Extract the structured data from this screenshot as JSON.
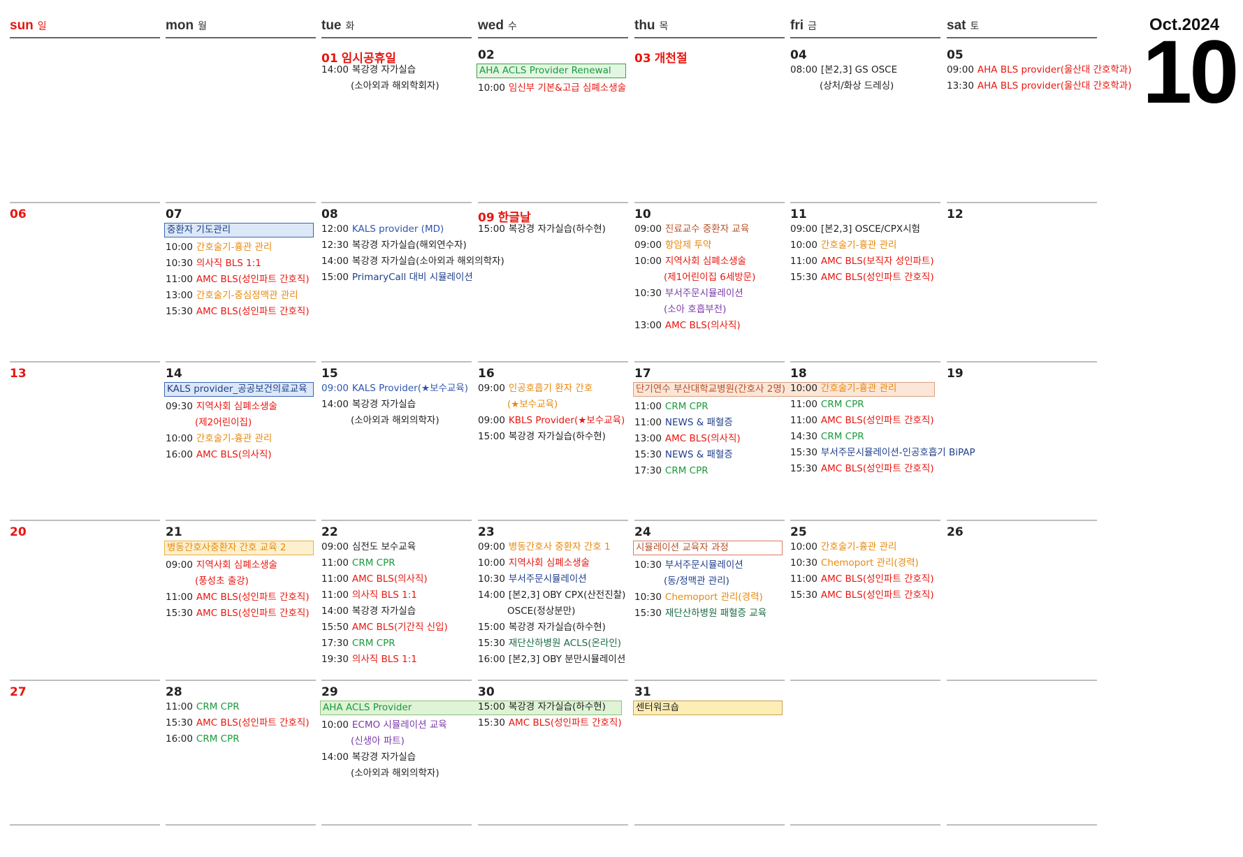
{
  "month": {
    "label": "Oct.2024",
    "number": "10"
  },
  "colors": {
    "black": "#1f1f1f",
    "red": "#e8160f",
    "orange": "#e8890c",
    "blue": "#2f55b0",
    "green": "#1a9a3c",
    "purple": "#7a3aa8",
    "brown": "#b5522a",
    "darkgreen": "#1b6a45",
    "navy": "#1f3f8a"
  },
  "weekdays": [
    {
      "en": "sun",
      "ko": "일",
      "color": "#e8160f"
    },
    {
      "en": "mon",
      "ko": "월",
      "color": "#333333"
    },
    {
      "en": "tue",
      "ko": "화",
      "color": "#333333"
    },
    {
      "en": "wed",
      "ko": "수",
      "color": "#333333"
    },
    {
      "en": "thu",
      "ko": "목",
      "color": "#333333"
    },
    {
      "en": "fri",
      "ko": "금",
      "color": "#333333"
    },
    {
      "en": "sat",
      "ko": "토",
      "color": "#333333"
    }
  ],
  "weeks": [
    {
      "days": [
        {
          "num": "",
          "red": false,
          "holiday": "",
          "events": []
        },
        {
          "num": "",
          "red": false,
          "holiday": "",
          "events": []
        },
        {
          "num": "01",
          "red": true,
          "holiday": "임시공휴일",
          "events": [
            {
              "time": "14:00",
              "text": "복강경 자가실습",
              "color": "black",
              "cont": "(소아외과 해외학회자)"
            }
          ]
        },
        {
          "num": "02",
          "red": false,
          "holiday": "",
          "events": [
            {
              "box": true,
              "text": "AHA ACLS Provider  Renewal",
              "color": "green",
              "bg": "#e3f6e3",
              "border": "#3aa040"
            },
            {
              "time": "10:00",
              "text": "임신부 기본&고급 심폐소생술",
              "color": "red"
            }
          ]
        },
        {
          "num": "03",
          "red": true,
          "holiday": "개천절",
          "events": []
        },
        {
          "num": "04",
          "red": false,
          "holiday": "",
          "events": [
            {
              "time": "08:00",
              "text": "[본2,3] GS OSCE",
              "color": "black",
              "cont": "(상처/화상 드레싱)"
            }
          ]
        },
        {
          "num": "05",
          "red": false,
          "holiday": "",
          "events": [
            {
              "time": "09:00",
              "text": "AHA BLS provider(울산대 간호학과)",
              "color": "red"
            },
            {
              "time": "13:30",
              "text": "AHA BLS provider(울산대 간호학과)",
              "color": "red"
            }
          ]
        }
      ]
    },
    {
      "days": [
        {
          "num": "06",
          "red": true,
          "holiday": "",
          "events": []
        },
        {
          "num": "07",
          "red": false,
          "holiday": "",
          "events": [
            {
              "box": true,
              "text": "중환자 기도관리",
              "color": "navy",
              "bg": "#dce8f7",
              "border": "#3a64b8"
            },
            {
              "time": "10:00",
              "text": "간호술기-흉관 관리",
              "color": "orange"
            },
            {
              "time": "10:30",
              "text": "의사직 BLS 1:1",
              "color": "red"
            },
            {
              "time": "11:00",
              "text": "AMC BLS(성인파트 간호직)",
              "color": "red"
            },
            {
              "time": "13:00",
              "text": "간호술기-중심정맥관 관리",
              "color": "orange"
            },
            {
              "time": "15:30",
              "text": "AMC BLS(성인파트 간호직)",
              "color": "red"
            }
          ]
        },
        {
          "num": "08",
          "red": false,
          "holiday": "",
          "events": [
            {
              "time": "12:00",
              "text": "KALS provider (MD)",
              "color": "blue"
            },
            {
              "time": "12:30",
              "text": "복강경 자가실습(해외연수자)",
              "color": "black"
            },
            {
              "time": "14:00",
              "text": "복강경 자가실습(소아외과 해외의학자)",
              "color": "black"
            },
            {
              "time": "15:00",
              "text": "PrimaryCall 대비 시뮬레이션",
              "color": "navy"
            }
          ]
        },
        {
          "num": "09",
          "red": true,
          "holiday": "한글날",
          "events": [
            {
              "time": "15:00",
              "text": "복강경 자가실습(하수현)",
              "color": "black"
            }
          ]
        },
        {
          "num": "10",
          "red": false,
          "holiday": "",
          "events": [
            {
              "time": "09:00",
              "text": "진료교수 중환자 교육",
              "color": "brown"
            },
            {
              "time": "09:00",
              "text": "항암제 투약",
              "color": "orange"
            },
            {
              "time": "10:00",
              "text": "지역사회 심폐소생술",
              "color": "red",
              "cont": "(제1어린이집 6세방문)"
            },
            {
              "time": "10:30",
              "text": "부서주문시뮬레이션",
              "color": "purple",
              "cont": "(소아 호흡부전)"
            },
            {
              "time": "13:00",
              "text": "AMC BLS(의사직)",
              "color": "red"
            }
          ]
        },
        {
          "num": "11",
          "red": false,
          "holiday": "",
          "events": [
            {
              "time": "09:00",
              "text": "[본2,3] OSCE/CPX시험",
              "color": "black"
            },
            {
              "time": "10:00",
              "text": "간호술기-흉관 관리",
              "color": "orange"
            },
            {
              "time": "11:00",
              "text": "AMC BLS(보직자 성인파트)",
              "color": "red"
            },
            {
              "time": "15:30",
              "text": "AMC BLS(성인파트 간호직)",
              "color": "red"
            }
          ]
        },
        {
          "num": "12",
          "red": false,
          "holiday": "",
          "events": []
        }
      ]
    },
    {
      "days": [
        {
          "num": "13",
          "red": true,
          "holiday": "",
          "events": []
        },
        {
          "num": "14",
          "red": false,
          "holiday": "",
          "events": [
            {
              "box": true,
              "text": "KALS provider_공공보건의료교육",
              "color": "navy",
              "bg": "#dce8f7",
              "border": "#3a64b8"
            },
            {
              "time": "09:30",
              "text": "지역사회 심폐소생술",
              "color": "red",
              "cont": "(제2어린이집)"
            },
            {
              "time": "10:00",
              "text": "간호술기-흉관 관리",
              "color": "orange"
            },
            {
              "time": "16:00",
              "text": "AMC BLS(의사직)",
              "color": "red"
            }
          ]
        },
        {
          "num": "15",
          "red": false,
          "holiday": "",
          "events": [
            {
              "time": "09:00",
              "text": "KALS Provider(★보수교육)",
              "color": "blue",
              "tcolor": "blue"
            },
            {
              "time": "14:00",
              "text": "복강경 자가실습",
              "color": "black",
              "cont": "(소아외과 해외의학자)"
            }
          ]
        },
        {
          "num": "16",
          "red": false,
          "holiday": "",
          "events": [
            {
              "time": "09:00",
              "text": "인공호흡기 환자 간호",
              "color": "orange",
              "cont": "(★보수교육)"
            },
            {
              "time": "09:00",
              "text": "KBLS Provider(★보수교육)",
              "color": "red"
            },
            {
              "time": "15:00",
              "text": "복강경 자가실습(하수현)",
              "color": "black"
            }
          ]
        },
        {
          "num": "17",
          "red": false,
          "holiday": "",
          "events": [
            {
              "box": true,
              "wide": true,
              "text": "단기연수 부산대학교병원(간호사 2명)",
              "color": "brown",
              "bg": "#fbe6d8",
              "border": "#d9a080"
            },
            {
              "time": "11:00",
              "text": "CRM CPR",
              "color": "green"
            },
            {
              "time": "11:00",
              "text": "NEWS & 패혈증",
              "color": "navy"
            },
            {
              "time": "13:00",
              "text": "AMC BLS(의사직)",
              "color": "red"
            },
            {
              "time": "15:30",
              "text": "NEWS & 패혈증",
              "color": "navy"
            },
            {
              "time": "17:30",
              "text": "CRM CPR",
              "color": "green"
            }
          ]
        },
        {
          "num": "18",
          "red": false,
          "holiday": "",
          "events": [
            {
              "time": "10:00",
              "text": "간호술기-흉관 관리",
              "color": "orange"
            },
            {
              "time": "11:00",
              "text": "CRM CPR",
              "color": "green"
            },
            {
              "time": "11:00",
              "text": "AMC BLS(성인파트 간호직)",
              "color": "red"
            },
            {
              "time": "14:30",
              "text": "CRM CPR",
              "color": "green"
            },
            {
              "time": "15:30",
              "text": "부서주문시뮬레이션-인공호흡기 BiPAP",
              "color": "navy"
            },
            {
              "time": "15:30",
              "text": "AMC BLS(성인파트 간호직)",
              "color": "red"
            }
          ]
        },
        {
          "num": "19",
          "red": false,
          "holiday": "",
          "events": []
        }
      ]
    },
    {
      "days": [
        {
          "num": "20",
          "red": true,
          "holiday": "",
          "events": []
        },
        {
          "num": "21",
          "red": false,
          "holiday": "",
          "events": [
            {
              "box": true,
              "text": "병동간호사중환자 간호 교육 2",
              "color": "orange",
              "bg": "#fdf0cf",
              "border": "#e8b040"
            },
            {
              "time": "09:00",
              "text": "지역사회 심폐소생술",
              "color": "red",
              "cont": "(풍성초 출강)"
            },
            {
              "time": "11:00",
              "text": "AMC BLS(성인파트  간호직)",
              "color": "red"
            },
            {
              "time": "15:30",
              "text": "AMC BLS(성인파트  간호직)",
              "color": "red"
            }
          ]
        },
        {
          "num": "22",
          "red": false,
          "holiday": "",
          "events": [
            {
              "time": "09:00",
              "text": "심전도 보수교육",
              "color": "black"
            },
            {
              "time": "11:00",
              "text": "CRM CPR",
              "color": "green"
            },
            {
              "time": "11:00",
              "text": "AMC BLS(의사직)",
              "color": "red"
            },
            {
              "time": "11:00",
              "text": "의사직 BLS 1:1",
              "color": "red"
            },
            {
              "time": "14:00",
              "text": "복강경 자가실습",
              "color": "black"
            },
            {
              "time": "15:50",
              "text": "AMC BLS(기간직 신입)",
              "color": "red"
            },
            {
              "time": "17:30",
              "text": "CRM CPR",
              "color": "green"
            },
            {
              "time": "19:30",
              "text": "의사직 BLS 1:1",
              "color": "red"
            }
          ]
        },
        {
          "num": "23",
          "red": false,
          "holiday": "",
          "events": [
            {
              "time": "09:00",
              "text": "병동간호사 중환자 간호 1",
              "color": "orange"
            },
            {
              "time": "10:00",
              "text": "지역사회 심폐소생술",
              "color": "red"
            },
            {
              "time": "10:30",
              "text": "부서주문시뮬레이션",
              "color": "navy"
            },
            {
              "time": "14:00",
              "text": "[본2,3] OBY CPX(산전진찰)",
              "color": "black",
              "cont": "OSCE(정상분만)"
            },
            {
              "time": "15:00",
              "text": "복강경 자가실습(하수현)",
              "color": "black"
            },
            {
              "time": "15:30",
              "text": "재단산하병원 ACLS(온라인)",
              "color": "darkgreen"
            },
            {
              "time": "16:00",
              "text": "[본2,3] OBY 분만시뮬레이션",
              "color": "black"
            }
          ]
        },
        {
          "num": "24",
          "red": false,
          "holiday": "",
          "events": [
            {
              "box": true,
              "text": "시뮬레이션 교육자 과정",
              "color": "brown",
              "bg": "#ffffff",
              "border": "#d97a6a"
            },
            {
              "time": "10:30",
              "text": "부서주문시뮬레이션",
              "color": "navy",
              "cont": "(동/정맥관 관리)"
            },
            {
              "time": "10:30",
              "text": "Chemoport 관리(경력)",
              "color": "orange"
            },
            {
              "time": "15:30",
              "text": "재단산하병원 패혈증 교육",
              "color": "darkgreen"
            }
          ]
        },
        {
          "num": "25",
          "red": false,
          "holiday": "",
          "events": [
            {
              "time": "10:00",
              "text": "간호술기-흉관 관리",
              "color": "orange"
            },
            {
              "time": "10:30",
              "text": "Chemoport 관리(경력)",
              "color": "orange"
            },
            {
              "time": "11:00",
              "text": "AMC BLS(성인파트 간호직)",
              "color": "red"
            },
            {
              "time": "15:30",
              "text": "AMC BLS(성인파트 간호직)",
              "color": "red"
            }
          ]
        },
        {
          "num": "26",
          "red": false,
          "holiday": "",
          "events": []
        }
      ]
    },
    {
      "days": [
        {
          "num": "27",
          "red": true,
          "holiday": "",
          "events": []
        },
        {
          "num": "28",
          "red": false,
          "holiday": "",
          "events": [
            {
              "time": "11:00",
              "text": "CRM CPR",
              "color": "green"
            },
            {
              "time": "15:30",
              "text": "AMC BLS(성인파트 간호직)",
              "color": "red"
            },
            {
              "time": "16:00",
              "text": "CRM CPR",
              "color": "green"
            }
          ]
        },
        {
          "num": "29",
          "red": false,
          "holiday": "",
          "events": [
            {
              "box": true,
              "span": 2,
              "text": "AHA ACLS Provider",
              "color": "green",
              "bg": "#dff3d6",
              "border": "#8cc07a"
            },
            {
              "time": "10:00",
              "text": "ECMO 시뮬레이션 교육",
              "color": "purple",
              "cont": "(신생아 파트)"
            },
            {
              "time": "14:00",
              "text": "복강경 자가실습",
              "color": "black",
              "cont": "(소아외과 해외의학자)"
            }
          ]
        },
        {
          "num": "30",
          "red": false,
          "holiday": "",
          "events": [
            {
              "time": "15:00",
              "text": "복강경 자가실습(하수현)",
              "color": "black"
            },
            {
              "time": "15:30",
              "text": "AMC BLS(성인파트 간호직)",
              "color": "red"
            }
          ]
        },
        {
          "num": "31",
          "red": false,
          "holiday": "",
          "events": [
            {
              "box": true,
              "text": "센터워크숍",
              "color": "black",
              "bg": "#fdeeb5",
              "border": "#c8a050"
            }
          ]
        },
        {
          "num": "",
          "red": false,
          "holiday": "",
          "events": []
        },
        {
          "num": "",
          "red": false,
          "holiday": "",
          "events": []
        }
      ]
    }
  ]
}
